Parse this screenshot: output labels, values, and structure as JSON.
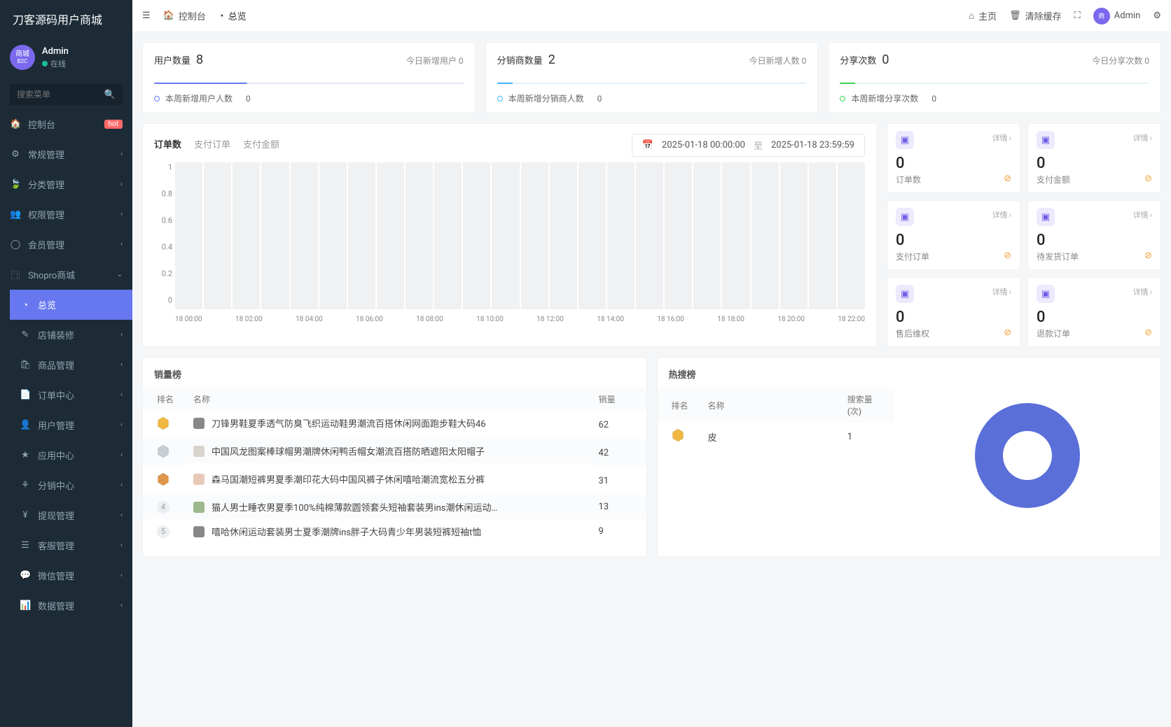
{
  "brand": "刀客源码用户商城",
  "user": {
    "avatarL1": "商城",
    "avatarL2": "B2C",
    "name": "Admin",
    "status": "在线"
  },
  "search": {
    "placeholder": "搜索菜单"
  },
  "nav": {
    "dashboard": "控制台",
    "hot": "hot",
    "general": "常规管理",
    "category": "分类管理",
    "auth": "权限管理",
    "member": "会员管理",
    "shopro": "Shopro商城",
    "overview": "总览",
    "decorate": "店铺装修",
    "goods": "商品管理",
    "order": "订单中心",
    "userMgmt": "用户管理",
    "appCenter": "应用中心",
    "distribution": "分销中心",
    "withdraw": "提现管理",
    "service": "客服管理",
    "wechat": "微信管理",
    "dataMgmt": "数据管理"
  },
  "topbar": {
    "console": "控制台",
    "overview": "总览",
    "home": "主页",
    "clearCache": "清除缓存",
    "admin": "Admin"
  },
  "stats": {
    "users": {
      "label": "用户数量",
      "value": "8",
      "todayLabel": "今日新增用户",
      "todayVal": "0",
      "weekLabel": "本周新增用户人数",
      "weekVal": "0"
    },
    "dist": {
      "label": "分销商数量",
      "value": "2",
      "todayLabel": "今日新增人数",
      "todayVal": "0",
      "weekLabel": "本周新增分销商人数",
      "weekVal": "0"
    },
    "share": {
      "label": "分享次数",
      "value": "0",
      "todayLabel": "今日分享次数",
      "todayVal": "0",
      "weekLabel": "本周新增分享次数",
      "weekVal": "0"
    }
  },
  "chartTabs": {
    "orders": "订单数",
    "paid": "支付订单",
    "amount": "支付金额"
  },
  "dateRange": {
    "from": "2025-01-18 00:00:00",
    "sep": "至",
    "to": "2025-01-18 23:59:59"
  },
  "chart_data": {
    "type": "bar",
    "ylim": [
      0,
      1
    ],
    "yticks": [
      "0",
      "0.2",
      "0.4",
      "0.6",
      "0.8",
      "1"
    ],
    "categories": [
      "18 00:00",
      "18 02:00",
      "18 04:00",
      "18 06:00",
      "18 08:00",
      "18 10:00",
      "18 12:00",
      "18 14:00",
      "18 16:00",
      "18 18:00",
      "18 20:00",
      "18 22:00"
    ],
    "values": [
      0,
      0,
      0,
      0,
      0,
      0,
      0,
      0,
      0,
      0,
      0,
      0,
      0,
      0,
      0,
      0,
      0,
      0,
      0,
      0,
      0,
      0,
      0,
      0
    ]
  },
  "mini": [
    {
      "val": "0",
      "label": "订单数",
      "detail": "详情"
    },
    {
      "val": "0",
      "label": "支付金额",
      "detail": "详情"
    },
    {
      "val": "0",
      "label": "支付订单",
      "detail": "详情"
    },
    {
      "val": "0",
      "label": "待发货订单",
      "detail": "详情"
    },
    {
      "val": "0",
      "label": "售后维权",
      "detail": "详情"
    },
    {
      "val": "0",
      "label": "退款订单",
      "detail": "详情"
    }
  ],
  "salesRank": {
    "title": "销量榜",
    "cols": {
      "rank": "排名",
      "name": "名称",
      "qty": "销量"
    },
    "rows": [
      {
        "name": "刀锋男鞋夏季透气防臭飞织运动鞋男潮流百搭休闲网面跑步鞋大码46",
        "qty": "62"
      },
      {
        "name": "中国风龙图案棒球帽男潮牌休闲鸭舌帽女潮流百搭防晒遮阳太阳帽子",
        "qty": "42"
      },
      {
        "name": "森马国潮短裤男夏季潮印花大码中国风裤子休闲嘻哈潮流宽松五分裤",
        "qty": "31"
      },
      {
        "name": "猫人男士睡衣男夏季100%纯棉薄款圆领套头短袖套装男ins潮休闲运动…",
        "qty": "13"
      },
      {
        "name": "嘻哈休闲运动套装男士夏季潮牌ins胖子大码青少年男装短裤短袖t恤",
        "qty": "9"
      }
    ]
  },
  "hotRank": {
    "title": "热搜榜",
    "cols": {
      "rank": "排名",
      "name": "名称",
      "count": "搜索量(次)"
    },
    "rows": [
      {
        "name": "皮",
        "count": "1"
      }
    ]
  }
}
